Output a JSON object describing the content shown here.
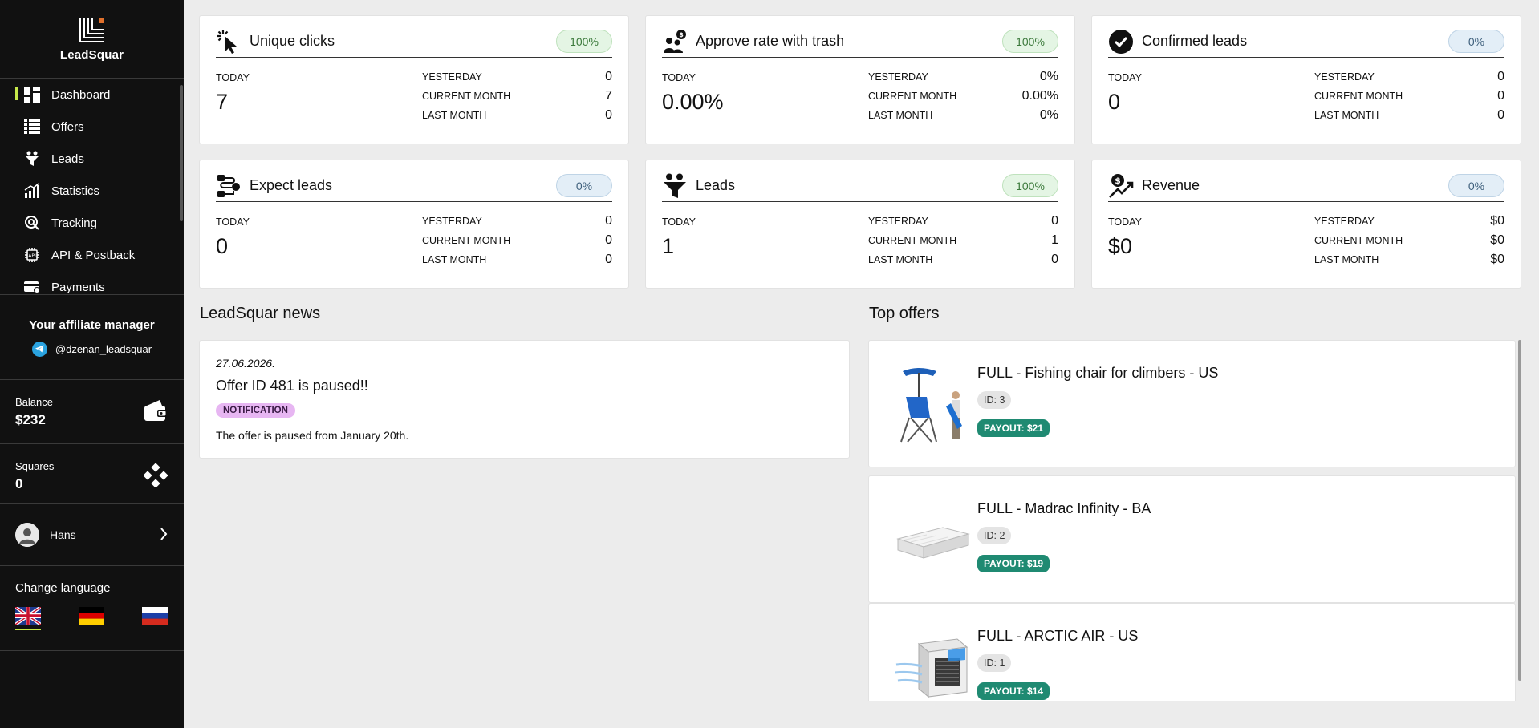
{
  "sidebar": {
    "brand": "LeadSquar",
    "nav": [
      {
        "label": "Dashboard",
        "icon": "dashboard-icon"
      },
      {
        "label": "Offers",
        "icon": "offers-list-icon"
      },
      {
        "label": "Leads",
        "icon": "leads-funnel-icon"
      },
      {
        "label": "Statistics",
        "icon": "statistics-chart-icon"
      },
      {
        "label": "Tracking",
        "icon": "tracking-icon"
      },
      {
        "label": "API & Postback",
        "icon": "api-chip-icon"
      },
      {
        "label": "Payments",
        "icon": "payments-card-icon"
      }
    ],
    "active_nav": "Dashboard",
    "manager_title": "Your affiliate manager",
    "manager_handle": "@dzenan_leadsquar",
    "balance_label": "Balance",
    "balance_value": "$232",
    "squares_label": "Squares",
    "squares_value": "0",
    "user_name": "Hans",
    "language_title": "Change language",
    "languages": [
      "English",
      "German",
      "Russian"
    ],
    "active_language": "English"
  },
  "stats": [
    {
      "title": "Unique clicks",
      "icon": "cursor-click-icon",
      "badge": "100%",
      "badge_color": "green",
      "today_label": "TODAY",
      "today": "7",
      "rows": [
        {
          "label": "YESTERDAY",
          "value": "0"
        },
        {
          "label": "CURRENT MONTH",
          "value": "7"
        },
        {
          "label": "LAST MONTH",
          "value": "0"
        }
      ]
    },
    {
      "title": "Approve rate with trash",
      "icon": "people-money-icon",
      "badge": "100%",
      "badge_color": "green",
      "today_label": "TODAY",
      "today": "0.00%",
      "rows": [
        {
          "label": "YESTERDAY",
          "value": "0%"
        },
        {
          "label": "CURRENT MONTH",
          "value": "0.00%"
        },
        {
          "label": "LAST MONTH",
          "value": "0%"
        }
      ]
    },
    {
      "title": "Confirmed leads",
      "icon": "check-circle-icon",
      "badge": "0%",
      "badge_color": "blue",
      "today_label": "TODAY",
      "today": "0",
      "rows": [
        {
          "label": "YESTERDAY",
          "value": "0"
        },
        {
          "label": "CURRENT MONTH",
          "value": "0"
        },
        {
          "label": "LAST MONTH",
          "value": "0"
        }
      ]
    },
    {
      "title": "Expect leads",
      "icon": "flow-route-icon",
      "badge": "0%",
      "badge_color": "blue",
      "today_label": "TODAY",
      "today": "0",
      "rows": [
        {
          "label": "YESTERDAY",
          "value": "0"
        },
        {
          "label": "CURRENT MONTH",
          "value": "0"
        },
        {
          "label": "LAST MONTH",
          "value": "0"
        }
      ]
    },
    {
      "title": "Leads",
      "icon": "leads-funnel-icon",
      "badge": "100%",
      "badge_color": "green",
      "today_label": "TODAY",
      "today": "1",
      "rows": [
        {
          "label": "YESTERDAY",
          "value": "0"
        },
        {
          "label": "CURRENT MONTH",
          "value": "1"
        },
        {
          "label": "LAST MONTH",
          "value": "0"
        }
      ]
    },
    {
      "title": "Revenue",
      "icon": "revenue-growth-icon",
      "badge": "0%",
      "badge_color": "blue",
      "today_label": "TODAY",
      "today": "$0",
      "rows": [
        {
          "label": "YESTERDAY",
          "value": "$0"
        },
        {
          "label": "CURRENT MONTH",
          "value": "$0"
        },
        {
          "label": "LAST MONTH",
          "value": "$0"
        }
      ]
    }
  ],
  "news": {
    "section_title": "LeadSquar news",
    "date": "27.06.2026.",
    "title": "Offer ID 481 is paused!!",
    "tag": "NOTIFICATION",
    "text": "The offer is paused from January 20th."
  },
  "offers": {
    "section_title": "Top offers",
    "items": [
      {
        "name": "FULL - Fishing chair for climbers - US",
        "id": "ID: 3",
        "payout": "PAYOUT: $21",
        "image": "fishing-chair-image"
      },
      {
        "name": "FULL - Madrac Infinity - BA",
        "id": "ID: 2",
        "payout": "PAYOUT: $19",
        "image": "mattress-image"
      },
      {
        "name": "FULL - ARCTIC AIR - US",
        "id": "ID: 1",
        "payout": "PAYOUT: $14",
        "image": "air-cooler-image"
      }
    ]
  },
  "colors": {
    "sidebar_bg": "#111111",
    "accent": "#c6e84a",
    "payout_green": "#1f8a72",
    "tag_purple": "#e7b6f2"
  }
}
